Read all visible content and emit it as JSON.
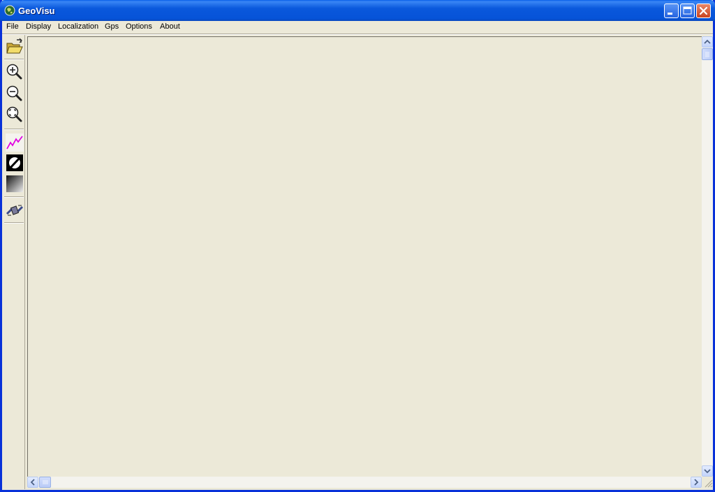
{
  "window": {
    "title": "GeoVisu"
  },
  "menu": {
    "items": [
      {
        "label": "File"
      },
      {
        "label": "Display"
      },
      {
        "label": "Localization"
      },
      {
        "label": "Gps"
      },
      {
        "label": "Options"
      },
      {
        "label": "About"
      }
    ]
  },
  "toolbar": {
    "tools": [
      {
        "name": "open-folder-icon"
      },
      {
        "name": "zoom-in-icon"
      },
      {
        "name": "zoom-out-icon"
      },
      {
        "name": "zoom-fit-icon"
      },
      {
        "name": "track-line-icon"
      },
      {
        "name": "no-display-icon"
      },
      {
        "name": "gradient-icon"
      },
      {
        "name": "satellite-icon"
      }
    ]
  },
  "colors": {
    "titlebar": "#0A58DC",
    "background": "#ECE9D8",
    "accent_track": "#E000E0"
  }
}
